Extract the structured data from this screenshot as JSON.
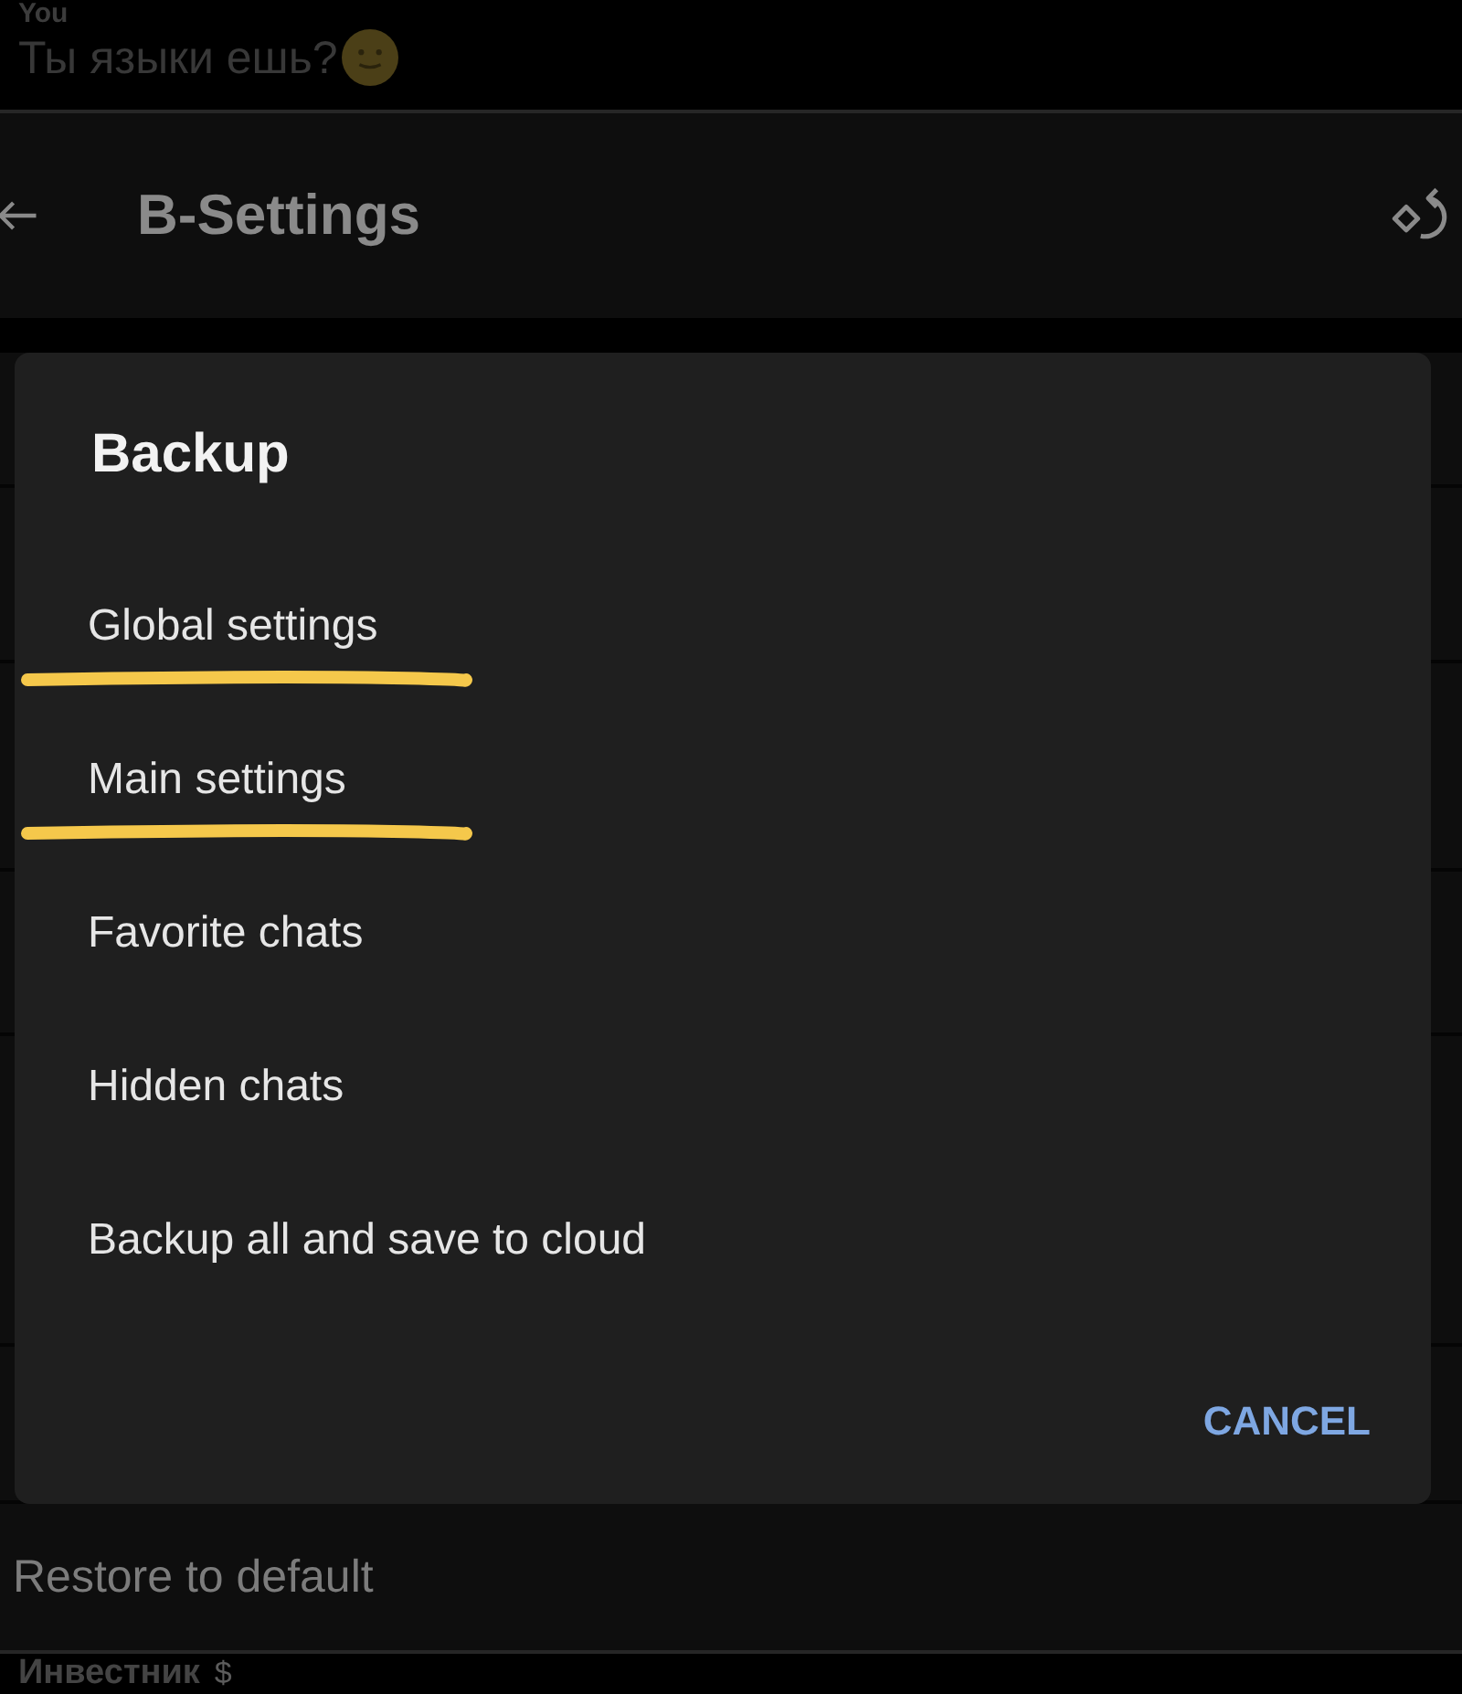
{
  "chat_preview": {
    "sender": "You",
    "message": "Ты языки ешь?"
  },
  "app_bar": {
    "title": "B-Settings"
  },
  "dialog": {
    "title": "Backup",
    "options": [
      {
        "label": "Global settings",
        "underlined": true
      },
      {
        "label": "Main settings",
        "underlined": true
      },
      {
        "label": "Favorite chats",
        "underlined": false
      },
      {
        "label": "Hidden chats",
        "underlined": false
      },
      {
        "label": "Backup all and save to cloud",
        "underlined": false
      }
    ],
    "buttons": [
      {
        "label": "CANCEL"
      }
    ]
  },
  "settings_list": {
    "items": [
      {
        "label": "Restore to default"
      }
    ]
  },
  "next_section": {
    "title": "Инвестник",
    "badge": "$"
  }
}
